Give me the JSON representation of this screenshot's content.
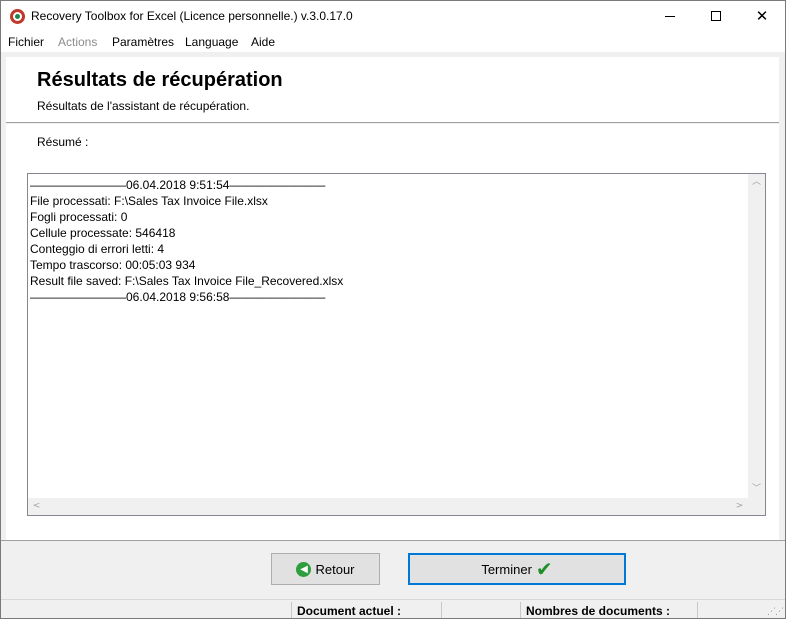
{
  "window": {
    "title": "Recovery Toolbox for Excel (Licence personnelle.) v.3.0.17.0"
  },
  "menu": {
    "items": [
      {
        "label": "Fichier",
        "enabled": true
      },
      {
        "label": "Actions",
        "enabled": false
      },
      {
        "label": "Paramètres",
        "enabled": true
      },
      {
        "label": "Language",
        "enabled": true
      },
      {
        "label": "Aide",
        "enabled": true
      }
    ]
  },
  "header": {
    "title": "Résultats de récupération",
    "subtitle": "Résultats de l'assistant de récupération."
  },
  "summary": {
    "label": "Résumé :",
    "lines": [
      "————————06.04.2018 9:51:54————————",
      "File processati: F:\\Sales Tax Invoice File.xlsx",
      "Fogli processati: 0",
      "Cellule processate: 546418",
      "Conteggio di errori letti: 4",
      "Tempo trascorso: 00:05:03 934",
      "Result file saved: F:\\Sales Tax Invoice File_Recovered.xlsx",
      "————————06.04.2018 9:56:58————————"
    ]
  },
  "buttons": {
    "back": "Retour",
    "finish": "Terminer"
  },
  "statusbar": {
    "current_document": "Document actuel :",
    "document_count": "Nombres de documents :"
  },
  "icons": {
    "app": "recovery-toolbox-icon",
    "back": "green-arrow-left-icon",
    "finish": "green-checkmark-icon"
  },
  "colors": {
    "accent_border": "#0078d7",
    "check_green": "#1f8f2a"
  }
}
